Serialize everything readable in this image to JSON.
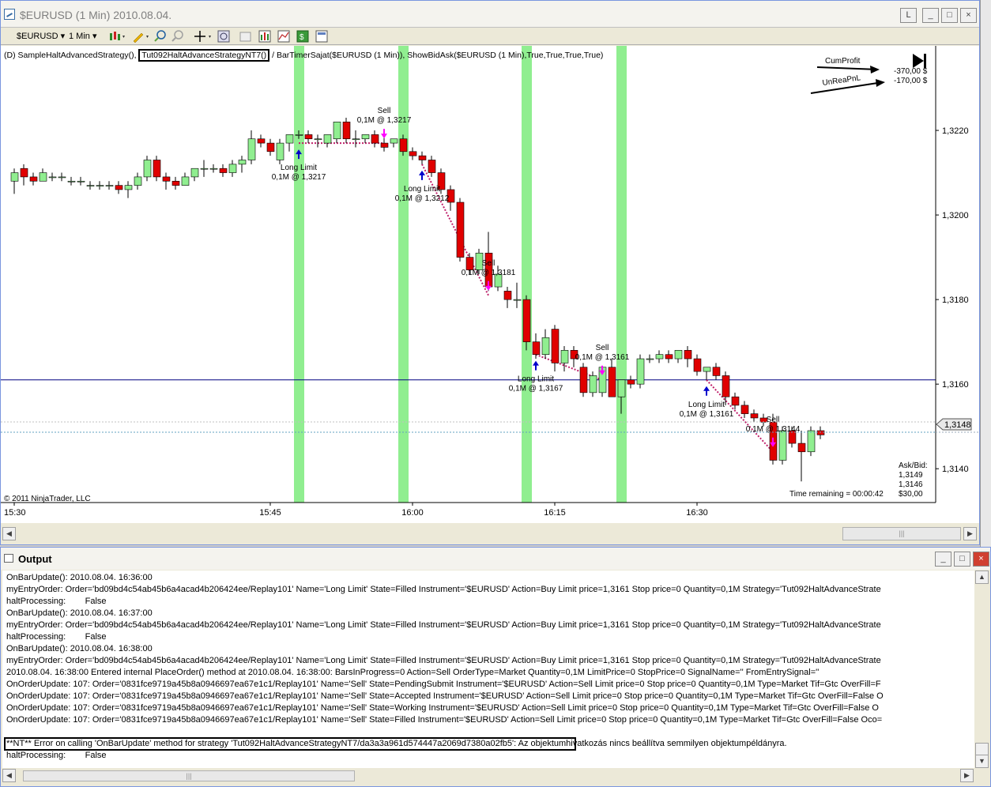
{
  "chart_window": {
    "title": "$EURUSD (1 Min)  2010.08.04.",
    "buttons": {
      "link": "L",
      "minimize": "_",
      "maximize": "□",
      "close": "×"
    }
  },
  "toolbar": {
    "instrument": "$EURUSD",
    "period": "1 Min",
    "icons": [
      "candlestick-style-icon",
      "pencil-draw-icon",
      "zoom-in-icon",
      "zoom-out-icon",
      "crosshair-icon",
      "properties-icon",
      "data-box-icon",
      "indicators-icon",
      "strategies-icon",
      "money-icon",
      "template-icon"
    ]
  },
  "chart": {
    "indicator_line_prefix": "(D) SampleHaltAdvancedStrategy(),",
    "indicator_line_boxed": "Tut092HaltAdvanceStrategyNT7()",
    "indicator_line_suffix": "/ BarTimerSajat($EURUSD (1 Min)),  ShowBidAsk($EURUSD (1 Min),True,True,True,True)",
    "cum_profit_label": "CumProfit",
    "unrea_pnl_label": "UnReaPnL",
    "cum_profit_value": "-370,00 $",
    "unrea_pnl_value": "-170,00 $",
    "copyright": "© 2011 NinjaTrader, LLC",
    "time_remaining": "Time remaining = 00:00:42",
    "ask_bid_label": "Ask/Bid:",
    "ask": "1,3149",
    "bid": "1,3146",
    "spread": "$30,00",
    "current_price_label": "1,3148",
    "colors": {
      "up": "#90ee90",
      "down": "#e00000",
      "band": "#90ee90",
      "buy_arrow": "#0000cc",
      "sell_arrow": "#ff00ff",
      "hline": "#000080"
    }
  },
  "chart_data": {
    "type": "candlestick",
    "ylim": [
      1.3132,
      1.324
    ],
    "y_ticks": [
      "1,3220",
      "1,3200",
      "1,3180",
      "1,3160",
      "1,3140"
    ],
    "y_tick_values": [
      1.322,
      1.32,
      1.318,
      1.316,
      1.314
    ],
    "x_tick_labels": [
      "15:30",
      "15:45",
      "16:00",
      "16:15",
      "16:30"
    ],
    "x_tick_bar_index": [
      0,
      27,
      42,
      57,
      72
    ],
    "horizontal_line": 1.3161,
    "highlight_bars": [
      30,
      41,
      54,
      64
    ],
    "candles": [
      [
        1.3208,
        1.3211,
        1.3205,
        1.321
      ],
      [
        1.3211,
        1.3212,
        1.3207,
        1.3209
      ],
      [
        1.3209,
        1.321,
        1.3207,
        1.3208
      ],
      [
        1.3208,
        1.3211,
        1.3208,
        1.321
      ],
      [
        1.3209,
        1.321,
        1.3208,
        1.3209
      ],
      [
        1.3209,
        1.321,
        1.3208,
        1.3209
      ],
      [
        1.3208,
        1.3209,
        1.3207,
        1.3208
      ],
      [
        1.3208,
        1.3209,
        1.3207,
        1.3208
      ],
      [
        1.3207,
        1.3208,
        1.3206,
        1.3207
      ],
      [
        1.3207,
        1.3208,
        1.3206,
        1.3207
      ],
      [
        1.3207,
        1.3208,
        1.3206,
        1.3207
      ],
      [
        1.3207,
        1.3208,
        1.3205,
        1.3206
      ],
      [
        1.3206,
        1.3208,
        1.3204,
        1.3207
      ],
      [
        1.3207,
        1.321,
        1.3206,
        1.3209
      ],
      [
        1.3209,
        1.3214,
        1.3208,
        1.3213
      ],
      [
        1.3213,
        1.3214,
        1.3208,
        1.3209
      ],
      [
        1.3209,
        1.321,
        1.3206,
        1.3208
      ],
      [
        1.3208,
        1.3209,
        1.3206,
        1.3207
      ],
      [
        1.3207,
        1.321,
        1.3207,
        1.3209
      ],
      [
        1.3209,
        1.3211,
        1.3208,
        1.3211
      ],
      [
        1.3211,
        1.3213,
        1.3209,
        1.3211
      ],
      [
        1.3211,
        1.3212,
        1.321,
        1.3211
      ],
      [
        1.3211,
        1.3212,
        1.3209,
        1.321
      ],
      [
        1.321,
        1.3213,
        1.3209,
        1.3212
      ],
      [
        1.3212,
        1.3214,
        1.321,
        1.3213
      ],
      [
        1.3213,
        1.322,
        1.3212,
        1.3218
      ],
      [
        1.3218,
        1.3219,
        1.3216,
        1.3217
      ],
      [
        1.3217,
        1.3218,
        1.3214,
        1.3215
      ],
      [
        1.3213,
        1.3218,
        1.3212,
        1.3217
      ],
      [
        1.3217,
        1.3219,
        1.3215,
        1.3219
      ],
      [
        1.3219,
        1.322,
        1.3218,
        1.3219
      ],
      [
        1.3219,
        1.322,
        1.3217,
        1.3218
      ],
      [
        1.3218,
        1.3219,
        1.3216,
        1.3218
      ],
      [
        1.3217,
        1.3219,
        1.3216,
        1.3219
      ],
      [
        1.3218,
        1.3222,
        1.3217,
        1.3222
      ],
      [
        1.3222,
        1.3223,
        1.3217,
        1.3218
      ],
      [
        1.3218,
        1.322,
        1.3216,
        1.3218
      ],
      [
        1.3218,
        1.3219,
        1.3217,
        1.3219
      ],
      [
        1.3219,
        1.322,
        1.3216,
        1.3217
      ],
      [
        1.3217,
        1.3219,
        1.3215,
        1.3216
      ],
      [
        1.3217,
        1.3218,
        1.3216,
        1.3218
      ],
      [
        1.3218,
        1.3219,
        1.3214,
        1.3215
      ],
      [
        1.3215,
        1.3216,
        1.3213,
        1.3214
      ],
      [
        1.3214,
        1.3215,
        1.3212,
        1.3213
      ],
      [
        1.3213,
        1.3214,
        1.3209,
        1.321
      ],
      [
        1.321,
        1.3211,
        1.3205,
        1.3206
      ],
      [
        1.3206,
        1.3207,
        1.3201,
        1.3203
      ],
      [
        1.3203,
        1.3204,
        1.3189,
        1.319
      ],
      [
        1.319,
        1.3191,
        1.3186,
        1.3187
      ],
      [
        1.3187,
        1.3192,
        1.3186,
        1.3191
      ],
      [
        1.3191,
        1.3196,
        1.3182,
        1.3183
      ],
      [
        1.3183,
        1.3188,
        1.3182,
        1.3186
      ],
      [
        1.3182,
        1.3183,
        1.3178,
        1.318
      ],
      [
        1.318,
        1.3184,
        1.3178,
        1.318
      ],
      [
        1.318,
        1.3181,
        1.3168,
        1.317
      ],
      [
        1.317,
        1.3172,
        1.3166,
        1.3167
      ],
      [
        1.3167,
        1.3173,
        1.3166,
        1.3171
      ],
      [
        1.3173,
        1.3174,
        1.3163,
        1.3165
      ],
      [
        1.3165,
        1.3169,
        1.3163,
        1.3168
      ],
      [
        1.3168,
        1.3169,
        1.3164,
        1.3166
      ],
      [
        1.3164,
        1.3165,
        1.3157,
        1.3158
      ],
      [
        1.3158,
        1.3163,
        1.3157,
        1.3162
      ],
      [
        1.3158,
        1.3164,
        1.3157,
        1.3164
      ],
      [
        1.3164,
        1.3166,
        1.3157,
        1.3157
      ],
      [
        1.3157,
        1.316,
        1.3153,
        1.3161
      ],
      [
        1.3161,
        1.3162,
        1.3159,
        1.316
      ],
      [
        1.316,
        1.3167,
        1.3159,
        1.3166
      ],
      [
        1.3166,
        1.3167,
        1.3165,
        1.3166
      ],
      [
        1.3166,
        1.3168,
        1.3165,
        1.3167
      ],
      [
        1.3167,
        1.3168,
        1.3165,
        1.3166
      ],
      [
        1.3166,
        1.3168,
        1.3165,
        1.3168
      ],
      [
        1.3168,
        1.3169,
        1.3164,
        1.3166
      ],
      [
        1.3166,
        1.3167,
        1.3162,
        1.3163
      ],
      [
        1.3163,
        1.3164,
        1.3161,
        1.3164
      ],
      [
        1.3164,
        1.3165,
        1.3161,
        1.3162
      ],
      [
        1.3162,
        1.3163,
        1.3155,
        1.3157
      ],
      [
        1.3157,
        1.3158,
        1.3154,
        1.3155
      ],
      [
        1.3155,
        1.3156,
        1.3152,
        1.3153
      ],
      [
        1.3153,
        1.3154,
        1.3151,
        1.3152
      ],
      [
        1.3152,
        1.3153,
        1.315,
        1.3151
      ],
      [
        1.3151,
        1.3153,
        1.3141,
        1.3142
      ],
      [
        1.3142,
        1.315,
        1.3141,
        1.3149
      ],
      [
        1.3149,
        1.315,
        1.3145,
        1.3146
      ],
      [
        1.3146,
        1.3149,
        1.3137,
        1.3144
      ],
      [
        1.3144,
        1.315,
        1.3143,
        1.3149
      ],
      [
        1.3149,
        1.315,
        1.3147,
        1.3148
      ]
    ],
    "buy_signals": [
      {
        "bar": 30,
        "price": 1.3217,
        "label1": "Long Limit",
        "label2": "0,1M @ 1,3217"
      },
      {
        "bar": 43,
        "price": 1.3212,
        "label1": "Long Limit",
        "label2": "0,1M @ 1,3212"
      },
      {
        "bar": 55,
        "price": 1.3167,
        "label1": "Long Limit",
        "label2": "0,1M @ 1,3167"
      },
      {
        "bar": 73,
        "price": 1.3161,
        "label1": "Long Limit",
        "label2": "0,1M @ 1,3161"
      }
    ],
    "sell_signals": [
      {
        "bar": 39,
        "price": 1.3217,
        "label1": "Sell",
        "label2": "0,1M @ 1,3217"
      },
      {
        "bar": 50,
        "price": 1.3181,
        "label1": "Sell",
        "label2": "0,1M @ 1,3181"
      },
      {
        "bar": 62,
        "price": 1.3161,
        "label1": "Sell",
        "label2": "0,1M @ 1,3161"
      },
      {
        "bar": 80,
        "price": 1.3144,
        "label1": "Sell",
        "label2": "0,1M @ 1,3144"
      }
    ]
  },
  "output": {
    "title": "Output",
    "lines": [
      "OnBarUpdate(): 2010.08.04. 16:36:00",
      "myEntryOrder: Order='bd09bd4c54ab45b6a4acad4b206424ee/Replay101' Name='Long Limit' State=Filled Instrument='$EURUSD' Action=Buy Limit price=1,3161 Stop price=0 Quantity=0,1M Strategy='Tut092HaltAdvanceStrate",
      "haltProcessing:        False",
      "OnBarUpdate(): 2010.08.04. 16:37:00",
      "myEntryOrder: Order='bd09bd4c54ab45b6a4acad4b206424ee/Replay101' Name='Long Limit' State=Filled Instrument='$EURUSD' Action=Buy Limit price=1,3161 Stop price=0 Quantity=0,1M Strategy='Tut092HaltAdvanceStrate",
      "haltProcessing:        False",
      "OnBarUpdate(): 2010.08.04. 16:38:00",
      "myEntryOrder: Order='bd09bd4c54ab45b6a4acad4b206424ee/Replay101' Name='Long Limit' State=Filled Instrument='$EURUSD' Action=Buy Limit price=1,3161 Stop price=0 Quantity=0,1M Strategy='Tut092HaltAdvanceStrate",
      "2010.08.04. 16:38:00 Entered internal PlaceOrder() method at 2010.08.04. 16:38:00: BarsInProgress=0 Action=Sell OrderType=Market Quantity=0,1M LimitPrice=0 StopPrice=0 SignalName='' FromEntrySignal=''",
      "OnOrderUpdate: 107: Order='0831fce9719a45b8a0946697ea67e1c1/Replay101' Name='Sell' State=PendingSubmit Instrument='$EURUSD' Action=Sell Limit price=0 Stop price=0 Quantity=0,1M Type=Market Tif=Gtc OverFill=F",
      "OnOrderUpdate: 107: Order='0831fce9719a45b8a0946697ea67e1c1/Replay101' Name='Sell' State=Accepted Instrument='$EURUSD' Action=Sell Limit price=0 Stop price=0 Quantity=0,1M Type=Market Tif=Gtc OverFill=False O",
      "OnOrderUpdate: 107: Order='0831fce9719a45b8a0946697ea67e1c1/Replay101' Name='Sell' State=Working Instrument='$EURUSD' Action=Sell Limit price=0 Stop price=0 Quantity=0,1M Type=Market Tif=Gtc OverFill=False O",
      "OnOrderUpdate: 107: Order='0831fce9719a45b8a0946697ea67e1c1/Replay101' Name='Sell' State=Filled Instrument='$EURUSD' Action=Sell Limit price=0 Stop price=0 Quantity=0,1M Type=Market Tif=Gtc OverFill=False Oco="
    ],
    "error_line_boxed": "**NT** Error on calling 'OnBarUpdate' method for strategy 'Tut092HaltAdvanceStrategyNT7/da3a3a961d574447a2069d7380a02fb5':",
    "error_line_rest": "Az objektumhivatkozás nincs beállítva semmilyen objektumpéldányra.",
    "last_line": "haltProcessing:        False"
  }
}
